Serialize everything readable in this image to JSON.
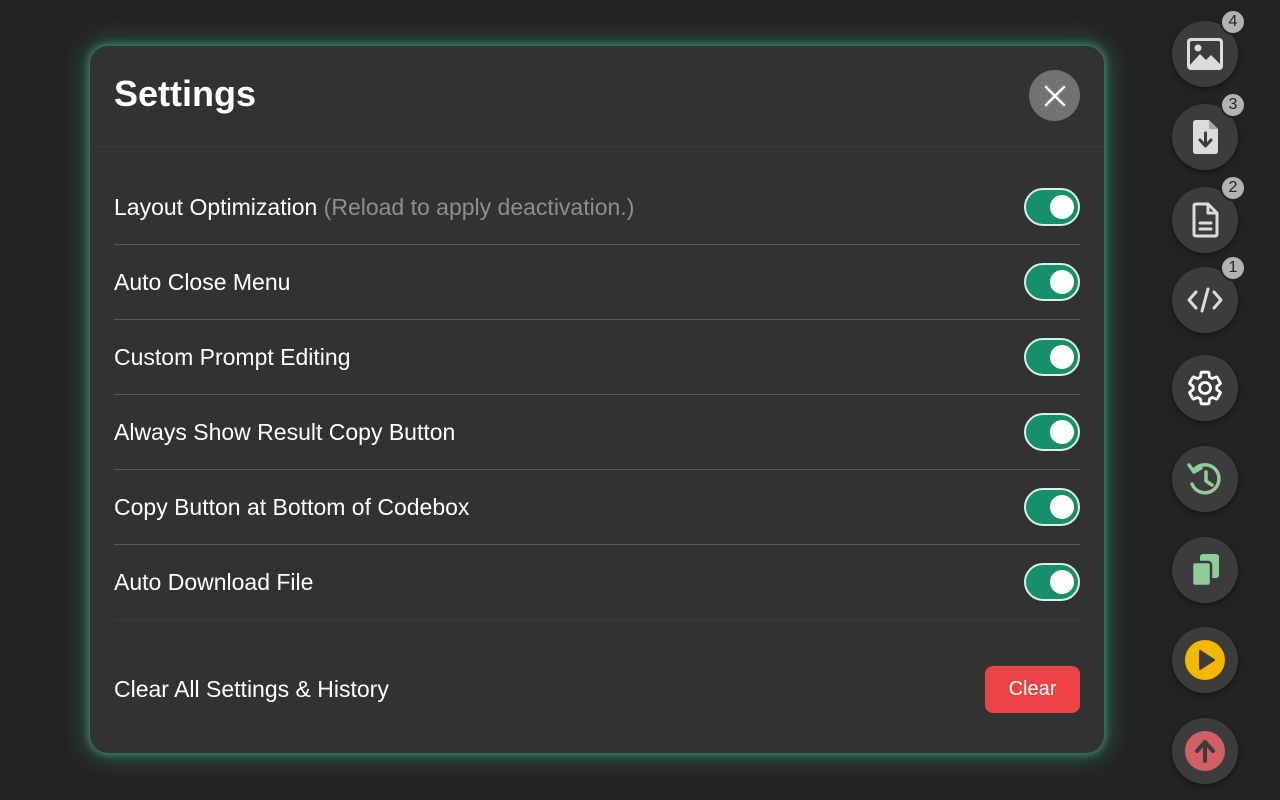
{
  "modal": {
    "title": "Settings",
    "close_icon": "close-icon",
    "settings": [
      {
        "label": "Layout Optimization",
        "note": "(Reload to apply deactivation.)",
        "enabled": true
      },
      {
        "label": "Auto Close Menu",
        "enabled": true
      },
      {
        "label": "Custom Prompt Editing",
        "enabled": true
      },
      {
        "label": "Always Show Result Copy Button",
        "enabled": true
      },
      {
        "label": "Copy Button at Bottom of Codebox",
        "enabled": true
      },
      {
        "label": "Auto Download File",
        "enabled": true
      }
    ],
    "clear": {
      "label": "Clear All Settings & History",
      "button_label": "Clear"
    }
  },
  "toolbar": {
    "buttons": [
      {
        "icon": "image-icon",
        "badge": "4"
      },
      {
        "icon": "file-download-icon",
        "badge": "3"
      },
      {
        "icon": "document-icon",
        "badge": "2"
      },
      {
        "icon": "code-icon",
        "badge": "1"
      },
      {
        "icon": "gear-icon"
      },
      {
        "icon": "history-icon"
      },
      {
        "icon": "copy-icon"
      },
      {
        "icon": "play-icon"
      },
      {
        "icon": "upload-arrow-icon"
      }
    ]
  },
  "colors": {
    "background": "#232323",
    "panel": "#323232",
    "toggle_on": "#16906b",
    "clear_button": "#ec4444",
    "history_icon": "#8fce98",
    "copy_icon": "#8fce98",
    "play_icon": "#f5b800",
    "upload_icon": "#d25e66",
    "glow": "#4cbe94"
  }
}
